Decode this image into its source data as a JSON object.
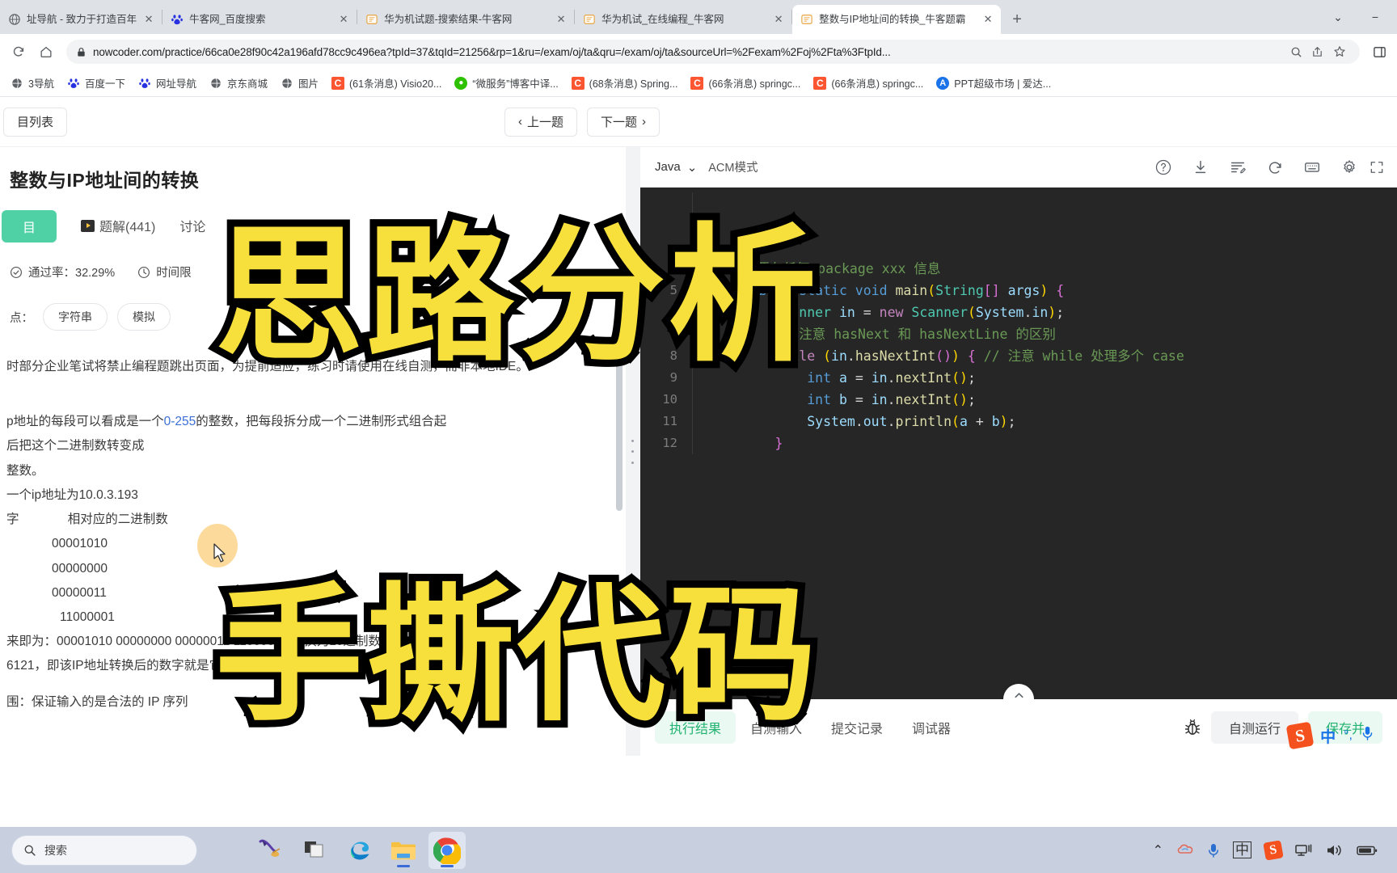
{
  "browser": {
    "tabs": [
      {
        "title": "址导航 - 致力于打造百年",
        "favicon": "globe-icon",
        "active": false
      },
      {
        "title": "牛客网_百度搜索",
        "favicon": "baidu-icon",
        "active": false
      },
      {
        "title": "华为机试题-搜索结果-牛客网",
        "favicon": "nowcoder-icon",
        "active": false
      },
      {
        "title": "华为机试_在线编程_牛客网",
        "favicon": "nowcoder-icon",
        "active": false
      },
      {
        "title": "整数与IP地址间的转换_牛客题霸",
        "favicon": "nowcoder-icon",
        "active": true
      }
    ],
    "new_tab_label": "+",
    "close_label": "✕",
    "window_controls": {
      "list": "⌄",
      "minimize": "−",
      "maximize": "□",
      "close": "✕"
    },
    "omnibox": {
      "url": "nowcoder.com/practice/66ca0e28f90c42a196afd78cc9c496ea?tpId=37&tqId=21256&rp=1&ru=/exam/oj/ta&qru=/exam/oj/ta&sourceUrl=%2Fexam%2Foj%2Fta%3FtpId...",
      "lock_icon": "lock-icon",
      "zoom_icon": "zoom-icon",
      "share_icon": "share-icon",
      "bookmark_icon": "star-icon",
      "sidepanel_icon": "sidepanel-icon"
    },
    "nav": {
      "reload_icon": "reload-icon",
      "home_icon": "home-icon"
    },
    "bookmarks": [
      {
        "label": "3导航",
        "icon": "globe-icon"
      },
      {
        "label": "百度一下",
        "icon": "baidu-icon"
      },
      {
        "label": "网址导航",
        "icon": "baidu-icon"
      },
      {
        "label": "京东商城",
        "icon": "globe-icon"
      },
      {
        "label": "图片",
        "icon": "globe-icon"
      },
      {
        "label": "(61条消息) Visio20...",
        "icon": "csdn-icon"
      },
      {
        "label": "“微服务”博客中译...",
        "icon": "wechat-icon"
      },
      {
        "label": "(68条消息) Spring...",
        "icon": "csdn-icon"
      },
      {
        "label": "(66条消息) springc...",
        "icon": "csdn-icon"
      },
      {
        "label": "(66条消息) springc...",
        "icon": "csdn-icon"
      },
      {
        "label": "PPT超级市场 | 爱达...",
        "icon": "ppt-icon"
      }
    ]
  },
  "question_nav": {
    "list_button": "目列表",
    "prev_button": "上一题",
    "next_button": "下一题",
    "prev_chevron": "‹",
    "next_chevron": "›"
  },
  "question": {
    "title": "整数与IP地址间的转换",
    "tabs": [
      {
        "label": "目",
        "active": true,
        "icon": null
      },
      {
        "label": "题解(441)",
        "active": false,
        "icon": "play-icon"
      },
      {
        "label": "讨论",
        "active": false,
        "icon": null
      }
    ],
    "meta": [
      {
        "icon": "check-circle-icon",
        "label": "通过率：32.29%"
      },
      {
        "icon": "clock-icon",
        "label": "时间限"
      }
    ],
    "tags_label": "点：",
    "tags": [
      "字符串",
      "模拟"
    ],
    "body": {
      "notice": "时部分企业笔试将禁止编程题跳出页面，为提前适应，练习时请使用在线自测，而非本地IDE。",
      "desc_line1_a": "p地址的每段可以看成是一个",
      "desc_line1_hl": "0-255",
      "desc_line1_b": "的整数，把每段拆分成一个二进制形式组合起",
      "desc_line2": "后把这个二进制数转变成",
      "desc_line3": "整数。",
      "example_line": "一个ip地址为10.0.3.193",
      "table_header": "字              相对应的二进制数",
      "binary_rows": [
        "00001010",
        "00000000",
        "00000011",
        "11000001"
      ],
      "result_line": "来即为：00001010 00000000 00000011 11000001,转换为10进制数就是：",
      "result_line2": "6121，即该IP地址转换后的数字就是它了。",
      "range_line": "围：保证输入的是合法的 IP 序列"
    }
  },
  "editor": {
    "lang": "Java",
    "mode_label": "ACM模式",
    "toolbar_icons": [
      {
        "name": "help-icon",
        "glyph": "?"
      },
      {
        "name": "download-icon",
        "glyph": "↓"
      },
      {
        "name": "format-code-icon",
        "glyph": "≡"
      },
      {
        "name": "reset-code-icon",
        "glyph": "↻"
      },
      {
        "name": "keyboard-icon",
        "glyph": "⌨"
      },
      {
        "name": "settings-gear-icon",
        "glyph": "⚙"
      },
      {
        "name": "fullscreen-icon",
        "glyph": "⛶"
      }
    ],
    "code_lines": [
      {
        "num": "",
        "tokens": []
      },
      {
        "num": "",
        "tokens": []
      },
      {
        "num": "",
        "tokens": []
      },
      {
        "num": "4",
        "tokens": [
          {
            "t": "cmt",
            "v": "    不要有任何 package xxx 信息"
          }
        ]
      },
      {
        "num": "5",
        "tokens": [
          {
            "t": "kw2",
            "v": "    public static void "
          },
          {
            "t": "fn",
            "v": "main"
          },
          {
            "t": "paren",
            "v": "("
          },
          {
            "t": "type",
            "v": "String"
          },
          {
            "t": "paren2",
            "v": "[]"
          },
          {
            "t": "var",
            "v": " args"
          },
          {
            "t": "paren",
            "v": ")"
          },
          {
            "t": "paren2",
            "v": " {"
          }
        ]
      },
      {
        "num": "6",
        "tokens": [
          {
            "t": "type",
            "v": "        Scanner"
          },
          {
            "t": "var",
            "v": " in "
          },
          {
            "t": "op",
            "v": "= "
          },
          {
            "t": "kw",
            "v": "new "
          },
          {
            "t": "type",
            "v": "Scanner"
          },
          {
            "t": "paren",
            "v": "("
          },
          {
            "t": "var",
            "v": "System"
          },
          {
            "t": "op",
            "v": "."
          },
          {
            "t": "var",
            "v": "in"
          },
          {
            "t": "paren",
            "v": ")"
          },
          {
            "t": "op",
            "v": ";"
          }
        ]
      },
      {
        "num": "7",
        "tokens": [
          {
            "t": "cmt",
            "v": "        // 注意 hasNext 和 hasNextLine 的区别"
          }
        ]
      },
      {
        "num": "8",
        "tokens": [
          {
            "t": "kw",
            "v": "        while "
          },
          {
            "t": "paren",
            "v": "("
          },
          {
            "t": "var",
            "v": "in"
          },
          {
            "t": "op",
            "v": "."
          },
          {
            "t": "fn",
            "v": "hasNextInt"
          },
          {
            "t": "paren2",
            "v": "()"
          },
          {
            "t": "paren",
            "v": ")"
          },
          {
            "t": "paren2",
            "v": " {"
          },
          {
            "t": "cmt",
            "v": " // 注意 while 处理多个 case"
          }
        ]
      },
      {
        "num": "9",
        "tokens": [
          {
            "t": "kw2",
            "v": "            int "
          },
          {
            "t": "var",
            "v": "a "
          },
          {
            "t": "op",
            "v": "= "
          },
          {
            "t": "var",
            "v": "in"
          },
          {
            "t": "op",
            "v": "."
          },
          {
            "t": "fn",
            "v": "nextInt"
          },
          {
            "t": "paren",
            "v": "()"
          },
          {
            "t": "op",
            "v": ";"
          }
        ]
      },
      {
        "num": "10",
        "tokens": [
          {
            "t": "kw2",
            "v": "            int "
          },
          {
            "t": "var",
            "v": "b "
          },
          {
            "t": "op",
            "v": "= "
          },
          {
            "t": "var",
            "v": "in"
          },
          {
            "t": "op",
            "v": "."
          },
          {
            "t": "fn",
            "v": "nextInt"
          },
          {
            "t": "paren",
            "v": "()"
          },
          {
            "t": "op",
            "v": ";"
          }
        ]
      },
      {
        "num": "11",
        "tokens": [
          {
            "t": "var",
            "v": "            System"
          },
          {
            "t": "op",
            "v": "."
          },
          {
            "t": "var",
            "v": "out"
          },
          {
            "t": "op",
            "v": "."
          },
          {
            "t": "fn",
            "v": "println"
          },
          {
            "t": "paren",
            "v": "("
          },
          {
            "t": "var",
            "v": "a "
          },
          {
            "t": "op",
            "v": "+ "
          },
          {
            "t": "var",
            "v": "b"
          },
          {
            "t": "paren",
            "v": ")"
          },
          {
            "t": "op",
            "v": ";"
          }
        ]
      },
      {
        "num": "12",
        "tokens": [
          {
            "t": "paren2",
            "v": "        }"
          }
        ]
      }
    ]
  },
  "bottom": {
    "tabs": [
      {
        "label": "执行结果",
        "active": true
      },
      {
        "label": "自测输入",
        "active": false
      },
      {
        "label": "提交记录",
        "active": false
      },
      {
        "label": "调试器",
        "active": false
      }
    ],
    "debug_icon": "bug-icon",
    "run_button": "自测运行",
    "save_button": "保存并",
    "collapse_icon": "chevron-up-icon"
  },
  "ime": {
    "logo": "S",
    "mode": "中",
    "punct": "°,",
    "mic_icon": "microphone-icon"
  },
  "taskbar": {
    "search_placeholder": "搜索",
    "search_icon": "magnifier-icon",
    "apps": [
      {
        "name": "snipaste-icon",
        "running": false,
        "active": false
      },
      {
        "name": "task-view-icon",
        "running": false,
        "active": false
      },
      {
        "name": "edge-icon",
        "running": false,
        "active": false
      },
      {
        "name": "file-explorer-icon",
        "running": true,
        "active": false
      },
      {
        "name": "chrome-icon",
        "running": true,
        "active": true
      }
    ],
    "tray": [
      {
        "name": "show-hidden-icons",
        "glyph": "⌃"
      },
      {
        "name": "onedrive-icon",
        "glyph": "◍"
      },
      {
        "name": "microphone-icon",
        "glyph": "🎙"
      },
      {
        "name": "ime-chinese-icon",
        "glyph": "中"
      },
      {
        "name": "sogou-icon",
        "glyph": "S"
      },
      {
        "name": "network-icon",
        "glyph": "🖧"
      },
      {
        "name": "volume-icon",
        "glyph": "🔊"
      },
      {
        "name": "battery-icon",
        "glyph": "🔋"
      }
    ]
  },
  "overlay": {
    "caption_1": "思路分析",
    "caption_2": "手撕代码"
  },
  "colors": {
    "accent_green": "#4fd1a5",
    "caption_yellow": "#f7e03c",
    "caption_stroke": "#000000",
    "editor_bg": "#262626",
    "link_blue": "#3b6fd6"
  }
}
